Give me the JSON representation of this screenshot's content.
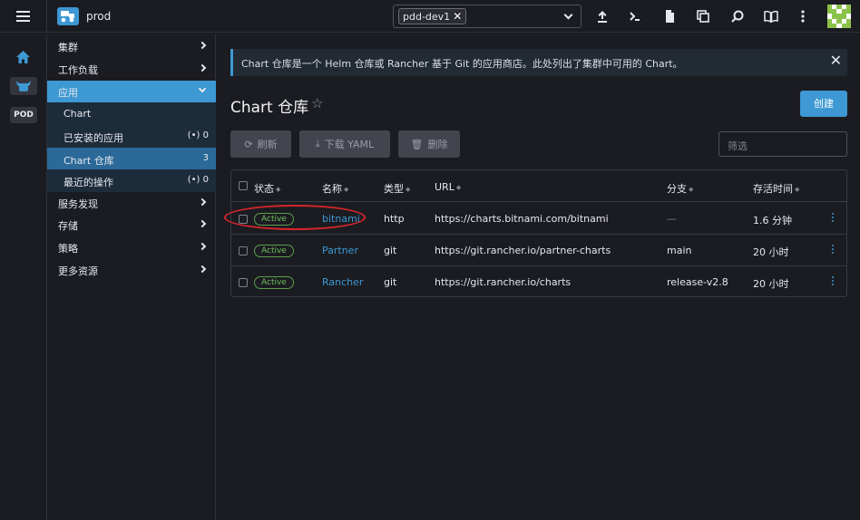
{
  "header": {
    "cluster_name": "prod",
    "namespace_chip": "pdd-dev1"
  },
  "rail": {
    "pod_label": "POD"
  },
  "sidenav": {
    "groups": [
      {
        "label": "集群"
      },
      {
        "label": "工作负载"
      },
      {
        "label": "应用"
      },
      {
        "label": "服务发现"
      },
      {
        "label": "存储"
      },
      {
        "label": "策略"
      },
      {
        "label": "更多资源"
      }
    ],
    "app_items": [
      {
        "label": "Chart",
        "count": ""
      },
      {
        "label": "已安装的应用",
        "count": "(•) 0"
      },
      {
        "label": "Chart 仓库",
        "count": "3"
      },
      {
        "label": "最近的操作",
        "count": "(•) 0"
      }
    ]
  },
  "main": {
    "banner_text": "Chart 仓库是一个 Helm 仓库或 Rancher 基于 Git 的应用商店。此处列出了集群中可用的 Chart。",
    "title": "Chart 仓库",
    "create_label": "创建",
    "refresh_label": "刷新",
    "download_label": "下载 YAML",
    "delete_label": "删除",
    "filter_placeholder": "筛选"
  },
  "table": {
    "columns": [
      "状态",
      "名称",
      "类型",
      "URL",
      "分支",
      "存活时间"
    ],
    "rows": [
      {
        "status": "Active",
        "name": "bitnami",
        "type": "http",
        "url": "https://charts.bitnami.com/bitnami",
        "branch": "—",
        "age": "1.6 分钟"
      },
      {
        "status": "Active",
        "name": "Partner",
        "type": "git",
        "url": "https://git.rancher.io/partner-charts",
        "branch": "main",
        "age": "20 小时"
      },
      {
        "status": "Active",
        "name": "Rancher",
        "type": "git",
        "url": "https://git.rancher.io/charts",
        "branch": "release-v2.8",
        "age": "20 小时"
      }
    ]
  },
  "colors": {
    "accent": "#3d98d3",
    "active_green": "#6fbf5d",
    "annotation_red": "#d7262b"
  }
}
